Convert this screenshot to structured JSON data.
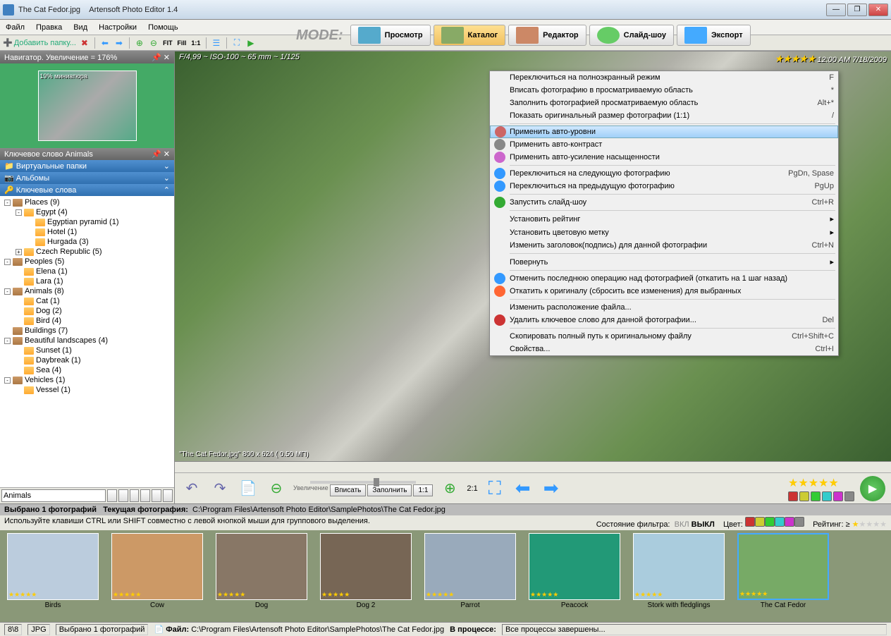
{
  "title": {
    "file": "The Cat Fedor.jpg",
    "app": "Artensoft Photo Editor 1.4"
  },
  "menu": [
    "Файл",
    "Правка",
    "Вид",
    "Настройки",
    "Помощь"
  ],
  "toolbar": {
    "add": "Добавить папку...",
    "fit": "FIT",
    "fill": "Fill",
    "one": "1:1"
  },
  "mode": {
    "label": "MODE:",
    "items": [
      "Просмотр",
      "Каталог",
      "Редактор",
      "Слайд-шоу",
      "Экспорт"
    ],
    "active": 1
  },
  "nav": {
    "title": "Навигатор. Увеличение = 176%",
    "thumb_pct": "19% миниатюра"
  },
  "panels": {
    "keyword_title": "Ключевое слово Animals",
    "virtual": "Виртуальные папки",
    "albums": "Альбомы",
    "keywords": "Ключевые слова"
  },
  "tree": [
    {
      "l": 0,
      "t": "-",
      "i": "brown",
      "x": "Places (9)"
    },
    {
      "l": 1,
      "t": "-",
      "i": "y",
      "x": "Egypt  (4)"
    },
    {
      "l": 2,
      "t": "",
      "i": "y",
      "x": "Egyptian pyramid  (1)"
    },
    {
      "l": 2,
      "t": "",
      "i": "y",
      "x": "Hotel  (1)"
    },
    {
      "l": 2,
      "t": "",
      "i": "y",
      "x": "Hurgada  (3)"
    },
    {
      "l": 1,
      "t": "+",
      "i": "y",
      "x": "Czech Republic  (5)"
    },
    {
      "l": 0,
      "t": "-",
      "i": "brown",
      "x": "Peoples (5)"
    },
    {
      "l": 1,
      "t": "",
      "i": "y",
      "x": "Elena  (1)"
    },
    {
      "l": 1,
      "t": "",
      "i": "y",
      "x": "Lara  (1)"
    },
    {
      "l": 0,
      "t": "-",
      "i": "brown",
      "x": "Animals  (8)"
    },
    {
      "l": 1,
      "t": "",
      "i": "y",
      "x": "Cat  (1)"
    },
    {
      "l": 1,
      "t": "",
      "i": "y",
      "x": "Dog  (2)"
    },
    {
      "l": 1,
      "t": "",
      "i": "y",
      "x": "Bird  (4)"
    },
    {
      "l": 0,
      "t": "",
      "i": "brown",
      "x": "Buildings (7)"
    },
    {
      "l": 0,
      "t": "-",
      "i": "brown",
      "x": "Beautiful landscapes  (4)"
    },
    {
      "l": 1,
      "t": "",
      "i": "y",
      "x": "Sunset  (1)"
    },
    {
      "l": 1,
      "t": "",
      "i": "y",
      "x": "Daybreak  (1)"
    },
    {
      "l": 1,
      "t": "",
      "i": "y",
      "x": "Sea  (4)"
    },
    {
      "l": 0,
      "t": "-",
      "i": "brown",
      "x": "Vehicles  (1)"
    },
    {
      "l": 1,
      "t": "",
      "i": "y",
      "x": "Vessel  (1)"
    }
  ],
  "keyword_input": "Animals",
  "exif": {
    "left": "F/4,99 ~ ISO-100 ~ 65 mm ~ 1/125",
    "right": "12:00 AM 7/18/2009"
  },
  "caption": "\"The Cat Fedor.jpg\"  800 x 624 ( 0.50 МП)",
  "ctrl": {
    "ratio": "2:1",
    "zoom_label": "Увеличение",
    "fit": "Вписать",
    "fill": "Заполнить",
    "one": "1:1"
  },
  "ctx": [
    {
      "x": "Переключиться на полноэкранный режим",
      "s": "F"
    },
    {
      "x": "Вписать фотографию в просматриваемую область",
      "s": "*"
    },
    {
      "x": "Заполнить фотографией просматриваемую область",
      "s": "Alt+*"
    },
    {
      "x": "Показать оригинальный размер фотографии (1:1)",
      "s": "/"
    },
    {
      "sep": true
    },
    {
      "x": "Применить авто-уровни",
      "hl": true,
      "ic": "#c66"
    },
    {
      "x": "Применить авто-контраст",
      "ic": "#888"
    },
    {
      "x": "Применить авто-усиление насыщенности",
      "ic": "#c6c"
    },
    {
      "sep": true
    },
    {
      "x": "Переключиться на следующую фотографию",
      "s": "PgDn, Spase",
      "ic": "#39f"
    },
    {
      "x": "Переключиться на предыдущую фотографию",
      "s": "PgUp",
      "ic": "#39f"
    },
    {
      "sep": true
    },
    {
      "x": "Запустить слайд-шоу",
      "s": "Ctrl+R",
      "ic": "#3a3"
    },
    {
      "sep": true
    },
    {
      "x": "Установить рейтинг",
      "sub": true
    },
    {
      "x": "Установить цветовую метку",
      "sub": true
    },
    {
      "x": "Изменить заголовок(подпись) для данной фотографии",
      "s": "Ctrl+N"
    },
    {
      "sep": true
    },
    {
      "x": "Повернуть",
      "sub": true
    },
    {
      "sep": true
    },
    {
      "x": "Отменить последнюю операцию над фотографией (откатить на 1 шаг назад)",
      "ic": "#39f"
    },
    {
      "x": "Откатить к оригиналу (сбросить все изменения) для выбранных",
      "ic": "#f63"
    },
    {
      "sep": true
    },
    {
      "x": "Изменить расположение файла..."
    },
    {
      "x": "Удалить ключевое слово для данной фотографии...",
      "s": "Del",
      "ic": "#c33"
    },
    {
      "sep": true
    },
    {
      "x": "Скопировать полный путь к оригинальному файлу",
      "s": "Ctrl+Shift+C"
    },
    {
      "x": "Свойства...",
      "s": "Ctrl+I"
    }
  ],
  "status1": {
    "sel": "Выбрано 1   фотографий",
    "cur": "Текущая фотография:",
    "path": "C:\\Program Files\\Artensoft Photo Editor\\SamplePhotos\\The Cat Fedor.jpg"
  },
  "hint": {
    "text": "Используйте клавиши CTRL или SHIFT совместно с левой кнопкой мыши для группового выделения.",
    "filter": "Состояние фильтра:",
    "on": "ВКЛ",
    "off": "ВЫКЛ",
    "color": "Цвет:",
    "rating": "Рейтинг: ≥"
  },
  "thumbs": [
    "Birds",
    "Cow",
    "Dog",
    "Dog 2",
    "Parrot",
    "Peacock",
    "Stork with fledglings",
    "The Cat Fedor"
  ],
  "status2": {
    "count": "8\\8",
    "fmt": "JPG",
    "sel": "Выбрано 1 фотографий",
    "file_lbl": "Файл:",
    "file": "C:\\Program Files\\Artensoft Photo Editor\\SamplePhotos\\The Cat Fedor.jpg",
    "proc_lbl": "В процессе:",
    "proc": "Все процессы завершены..."
  },
  "colors": [
    "#c33",
    "#cc3",
    "#3c3",
    "#3cc",
    "#c3c",
    "#888"
  ]
}
